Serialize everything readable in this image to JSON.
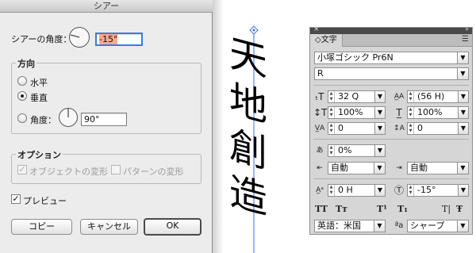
{
  "dialog": {
    "title": "シアー",
    "shear_angle_label": "シアーの角度：",
    "shear_angle_value": "-15°",
    "axis_group_title": "方向",
    "axis_horizontal": "水平",
    "axis_vertical": "垂直",
    "axis_angle_label": "角度：",
    "axis_angle_value": "90°",
    "options_group_title": "オプション",
    "opt_objects": "オブジェクトの変形",
    "opt_patterns": "パターンの変形",
    "preview_label": "プレビュー",
    "copy_btn": "コピー",
    "cancel_btn": "キャンセル",
    "ok_btn": "OK"
  },
  "canvas": {
    "chars": [
      "天",
      "地",
      "創",
      "造"
    ]
  },
  "panel": {
    "tab": "◇文字",
    "font_family": "小塚ゴシック Pr6N",
    "font_style": "R",
    "font_size": "32 Q",
    "leading": "(56 H)",
    "vert_scale": "100%",
    "horiz_scale": "100%",
    "kerning": "0",
    "tracking": "0",
    "tsume": "0%",
    "aki_before": "自動",
    "aki_after": "自動",
    "baseline_shift": "0 H",
    "char_rotation": "-15°",
    "language": "英語：米国",
    "antialias": "シャープ",
    "aa_icon": "ªa"
  },
  "colors": {
    "dialog_bg": "#ececec",
    "panel_bg": "#d6d6d6",
    "highlight": "#f6a98f",
    "guide": "#3a6fe0"
  }
}
